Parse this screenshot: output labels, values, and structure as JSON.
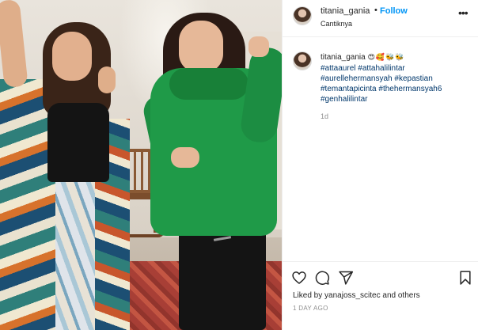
{
  "header": {
    "username": "titania_gania",
    "separator": "•",
    "follow_label": "Follow",
    "location": "Cantiknya",
    "more_icon": "more-options-icon"
  },
  "caption": {
    "username": "titania_gania",
    "emojis": "😍🥰🐝🐝",
    "hashtags": [
      "#attaaurel #attahalilintar",
      "#aurellehermansyah #kepastian",
      "#temantapicinta #thehermansyah6",
      "#genhalilintar"
    ],
    "time": "1d"
  },
  "actions": {
    "like_icon": "heart-icon",
    "comment_icon": "comment-icon",
    "share_icon": "share-icon",
    "save_icon": "bookmark-icon"
  },
  "likes": {
    "prefix": "Liked by",
    "user": "yanajoss_scitec",
    "suffix": "and others"
  },
  "date": "1 DAY AGO",
  "colors": {
    "follow": "#0095f6",
    "hashtag": "#00376b",
    "muted": "#8e8e8e"
  }
}
